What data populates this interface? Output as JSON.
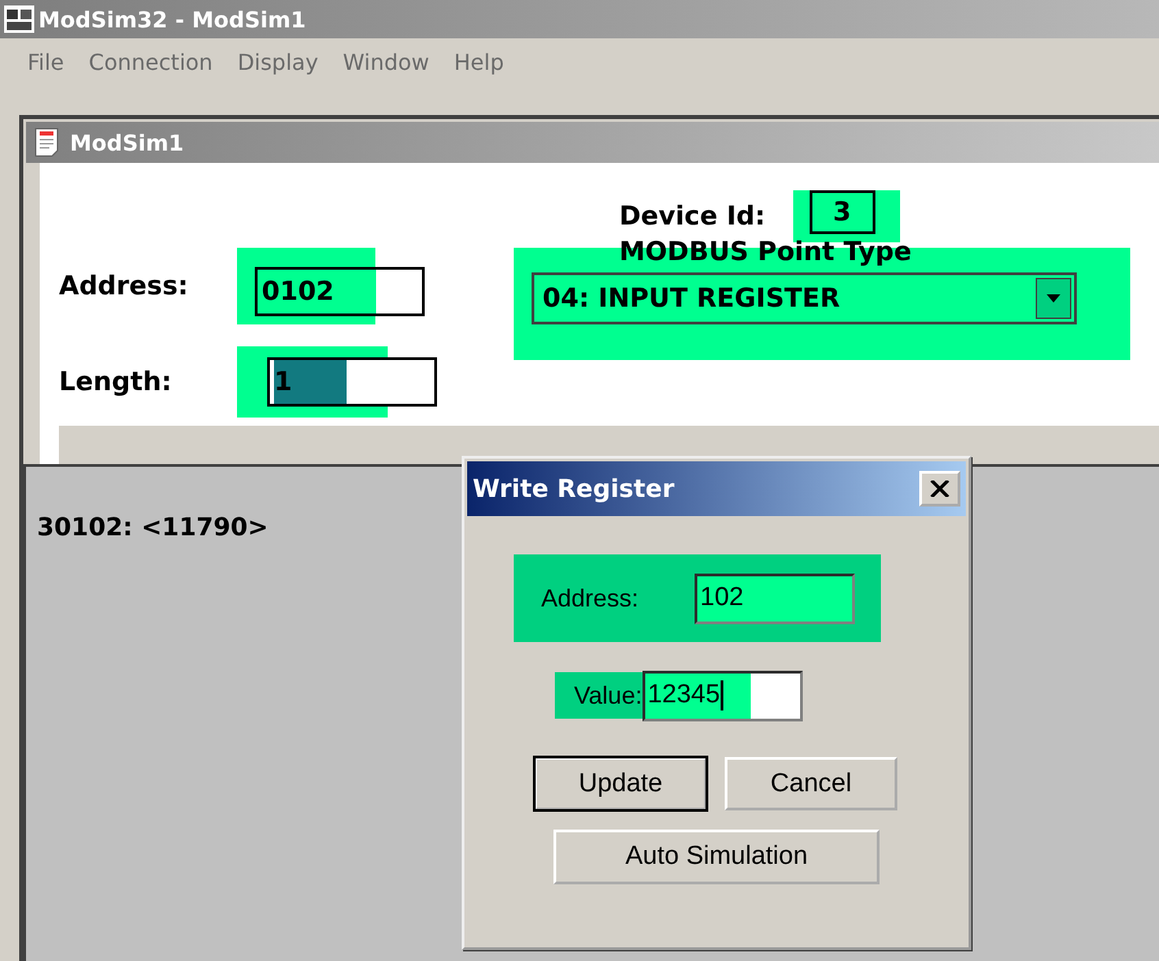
{
  "window": {
    "title": "ModSim32 - ModSim1"
  },
  "menu": [
    {
      "label": "File"
    },
    {
      "label": "Connection"
    },
    {
      "label": "Display"
    },
    {
      "label": "Window"
    },
    {
      "label": "Help"
    }
  ],
  "child_window": {
    "title": "ModSim1",
    "device_id": {
      "label": "Device Id:",
      "value": "3",
      "highlighted": true
    },
    "address": {
      "label": "Address:",
      "value": "0102",
      "highlighted": true
    },
    "length": {
      "label": "Length:",
      "value": "1",
      "highlighted": true,
      "value_selected": true
    },
    "point_type": {
      "label": "MODBUS Point Type",
      "value": "04: INPUT REGISTER",
      "highlighted": true
    },
    "readings": [
      "30102: <11790>"
    ]
  },
  "dialog": {
    "title": "Write Register",
    "fields": [
      {
        "label": "Address:",
        "value": "102",
        "highlighted": true,
        "caret": false
      },
      {
        "label": "Value:",
        "value": "12345",
        "highlighted": true,
        "caret": true
      }
    ],
    "buttons": [
      {
        "label": "Update",
        "default": true
      },
      {
        "label": "Cancel",
        "default": false
      }
    ],
    "wide_button": {
      "label": "Auto Simulation"
    }
  }
}
